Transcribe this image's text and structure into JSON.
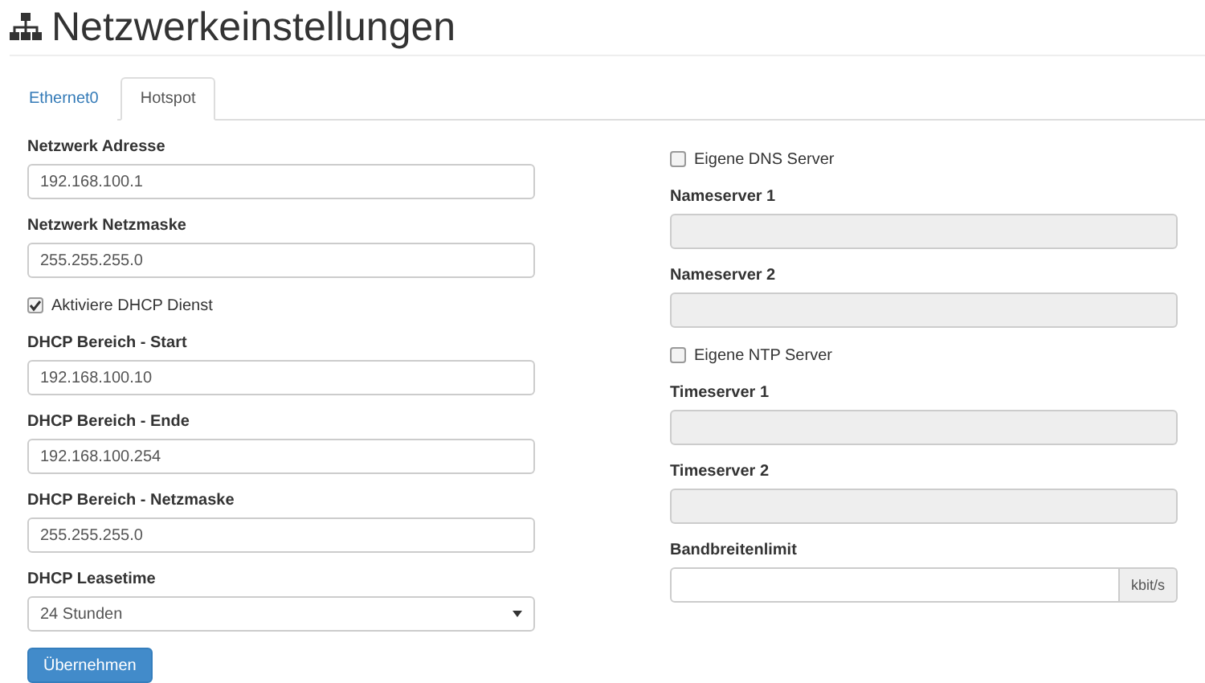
{
  "title": "Netzwerkeinstellungen",
  "tabs": [
    {
      "label": "Ethernet0",
      "selected": false
    },
    {
      "label": "Hotspot",
      "selected": true
    }
  ],
  "columns": [
    [
      {
        "kind": "field",
        "label": "Netzwerk Adresse",
        "value": "192.168.100.1",
        "disabled": false
      },
      {
        "kind": "field",
        "label": "Netzwerk Netzmaske",
        "value": "255.255.255.0",
        "disabled": false
      },
      {
        "kind": "checkbox",
        "label": "Aktiviere DHCP Dienst",
        "checked": true
      },
      {
        "kind": "field",
        "label": "DHCP Bereich - Start",
        "value": "192.168.100.10",
        "disabled": false
      },
      {
        "kind": "field",
        "label": "DHCP Bereich - Ende",
        "value": "192.168.100.254",
        "disabled": false
      },
      {
        "kind": "field",
        "label": "DHCP Bereich - Netzmaske",
        "value": "255.255.255.0",
        "disabled": false
      },
      {
        "kind": "select",
        "label": "DHCP Leasetime",
        "value": "24 Stunden"
      }
    ],
    [
      {
        "kind": "checkbox",
        "label": "Eigene DNS Server",
        "checked": false
      },
      {
        "kind": "field",
        "label": "Nameserver 1",
        "disabled": true
      },
      {
        "kind": "field",
        "label": "Nameserver 2",
        "disabled": true
      },
      {
        "kind": "checkbox",
        "label": "Eigene NTP Server",
        "checked": false
      },
      {
        "kind": "field",
        "label": "Timeserver 1",
        "disabled": true
      },
      {
        "kind": "field",
        "label": "Timeserver 2",
        "disabled": true
      },
      {
        "kind": "addon",
        "label": "Bandbreitenlimit",
        "addon": "kbit/s"
      }
    ]
  ],
  "submit": "Übernehmen"
}
